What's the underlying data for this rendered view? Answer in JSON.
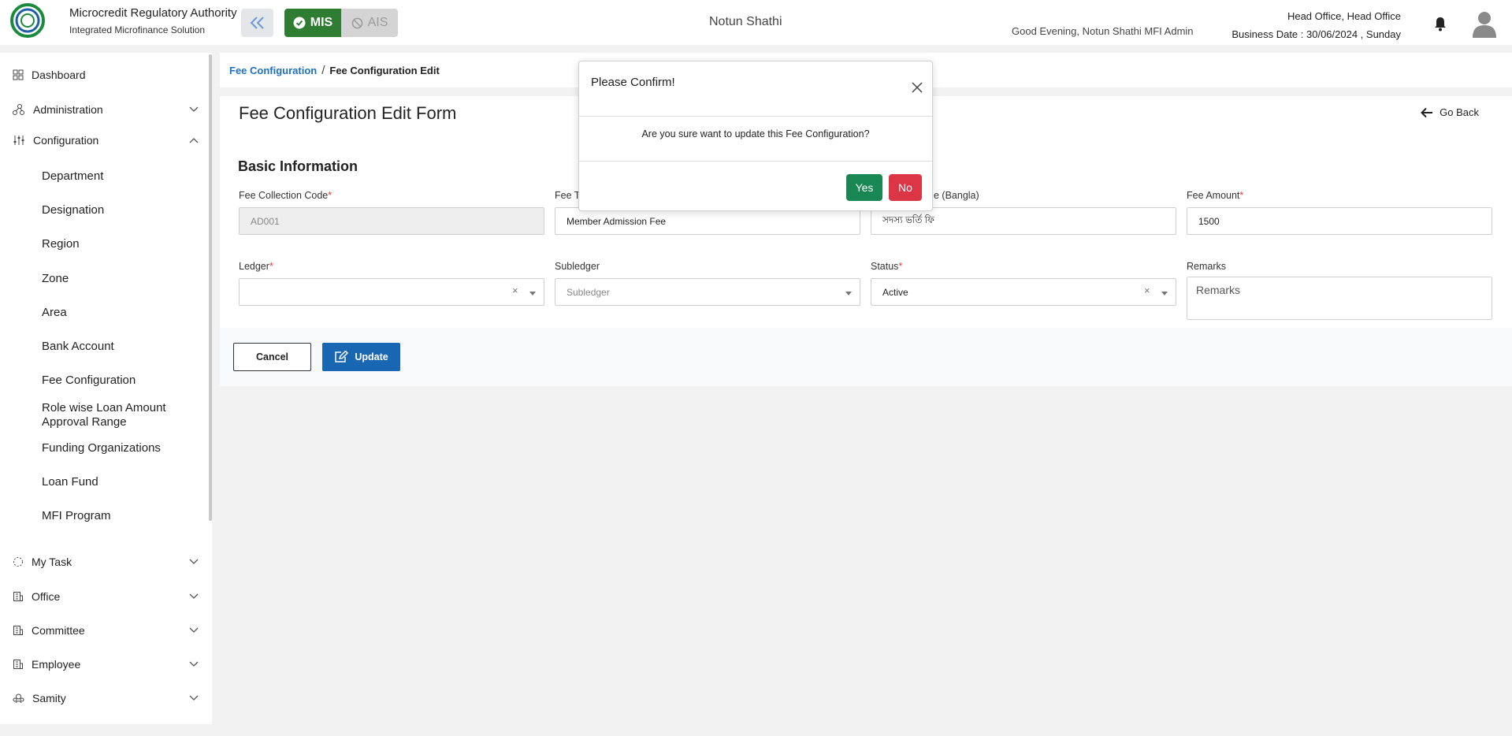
{
  "header": {
    "logo_text": "Microcredit Regulatory Authority",
    "brand_title": "Microcredit Regulatory Authority",
    "brand_subtitle": "Integrated Microfinance Solution",
    "mis_label": "MIS",
    "ais_label": "AIS",
    "center_title": "Notun Shathi",
    "greeting": "Good Evening, Notun Shathi MFI Admin",
    "office": "Head Office, Head Office",
    "business_date": "Business Date : 30/06/2024 , Sunday",
    "accent_color": "#2e7d32"
  },
  "sidebar": {
    "dashboard": "Dashboard",
    "administration": "Administration",
    "configuration": "Configuration",
    "config_items": [
      "Department",
      "Designation",
      "Region",
      "Zone",
      "Area",
      "Bank Account",
      "Fee Configuration",
      "Role wise Loan Amount Approval Range",
      "Funding Organizations",
      "Loan Fund",
      "MFI Program"
    ],
    "my_task": "My Task",
    "office": "Office",
    "committee": "Committee",
    "employee": "Employee",
    "samity": "Samity"
  },
  "breadcrumb": {
    "link": "Fee Configuration",
    "separator": "/",
    "current": "Fee Configuration Edit"
  },
  "form": {
    "title": "Fee Configuration Edit Form",
    "go_back": "Go Back",
    "section": "Basic Information",
    "fee_code_label": "Fee Collection Code",
    "fee_code_value": "AD001",
    "fee_type_label": "Fee T",
    "fee_type_value": "Member Admission Fee",
    "fee_bangla_label": "e (Bangla)",
    "fee_bangla_value": "সদস্য ভর্তি ফি",
    "fee_amount_label": "Fee Amount",
    "fee_amount_value": "1500",
    "ledger_label": "Ledger",
    "subledger_label": "Subledger",
    "subledger_placeholder": "Subledger",
    "status_label": "Status",
    "status_value": "Active",
    "remarks_label": "Remarks",
    "remarks_placeholder": "Remarks",
    "required_mark": "*",
    "clear_mark": "×",
    "cancel": "Cancel",
    "update": "Update"
  },
  "modal": {
    "title": "Please Confirm!",
    "message": "Are you sure want to update this Fee Configuration?",
    "yes": "Yes",
    "no": "No"
  }
}
